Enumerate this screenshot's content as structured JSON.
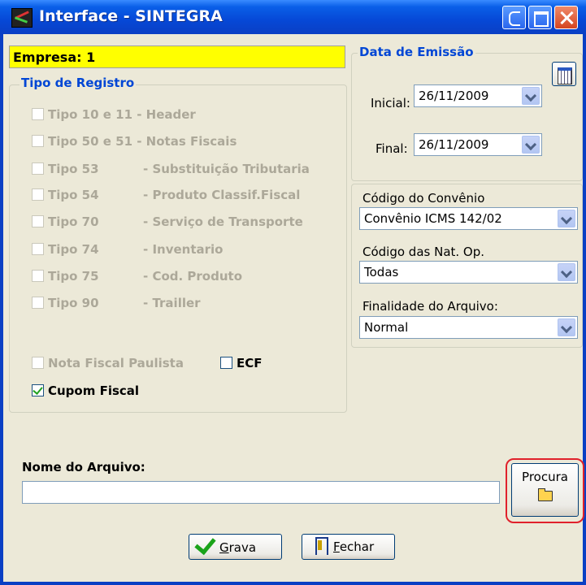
{
  "window": {
    "title": "Interface - SINTEGRA"
  },
  "empresa": "Empresa: 1",
  "tipo_registro": {
    "legend": "Tipo de Registro",
    "items": [
      {
        "a": "Tipo 10 e 11 - Header",
        "b": ""
      },
      {
        "a": "Tipo 50 e 51 - Notas Fiscais",
        "b": ""
      },
      {
        "a": "Tipo 53",
        "b": "- Substituição Tributaria"
      },
      {
        "a": "Tipo 54",
        "b": "- Produto Classif.Fiscal"
      },
      {
        "a": "Tipo 70",
        "b": "- Serviço de Transporte"
      },
      {
        "a": "Tipo 74",
        "b": "- Inventario"
      },
      {
        "a": "Tipo 75",
        "b": "- Cod. Produto"
      },
      {
        "a": "Tipo 90",
        "b": "- Trailler"
      }
    ],
    "nota_fiscal_paulista": "Nota Fiscal Paulista",
    "ecf": "ECF",
    "cupom_fiscal": "Cupom Fiscal"
  },
  "data_emissao": {
    "legend": "Data de Emissão",
    "inicial_label": "Inicial:",
    "inicial_value": "26/11/2009",
    "final_label": "Final:",
    "final_value": "26/11/2009"
  },
  "codigo_convenio": {
    "label": "Código do Convênio",
    "value": "Convênio ICMS 142/02"
  },
  "codigo_nat_op": {
    "label": "Código das Nat. Op.",
    "value": "Todas"
  },
  "finalidade": {
    "label": "Finalidade do Arquivo:",
    "value": "Normal"
  },
  "nome_arquivo": {
    "label": "Nome do Arquivo:",
    "value": ""
  },
  "buttons": {
    "procura": "Procura",
    "grava_u": "G",
    "grava_rest": "rava",
    "fechar_u": "F",
    "fechar_rest": "echar"
  }
}
